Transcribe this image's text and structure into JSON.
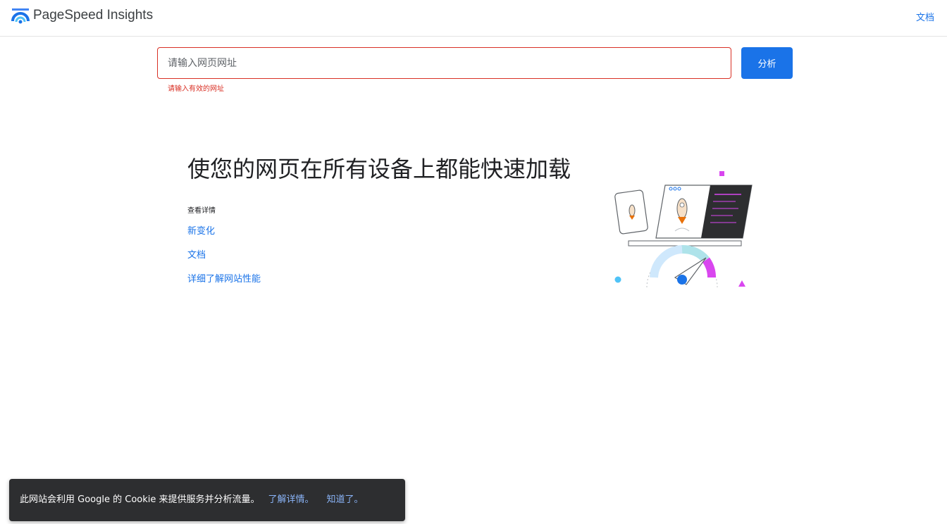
{
  "header": {
    "app_title": "PageSpeed Insights",
    "docs_link": "文档",
    "logo_icon": "pagespeed-gauge-icon"
  },
  "search": {
    "placeholder": "请输入网页网址",
    "value": "",
    "error_message": "请输入有效的网址",
    "analyze_label": "分析"
  },
  "main": {
    "headline": "使您的网页在所有设备上都能快速加载",
    "details_heading": "查看详情",
    "links": [
      {
        "label": "新变化"
      },
      {
        "label": "文档"
      },
      {
        "label": "详细了解网站性能"
      }
    ]
  },
  "cookie_banner": {
    "message": "此网站会利用 Google 的 Cookie 来提供服务并分析流量。",
    "learn_more": "了解详情。",
    "dismiss": "知道了。"
  },
  "colors": {
    "accent": "#1a73e8",
    "error": "#d93025",
    "banner_bg": "#2d2e30"
  }
}
